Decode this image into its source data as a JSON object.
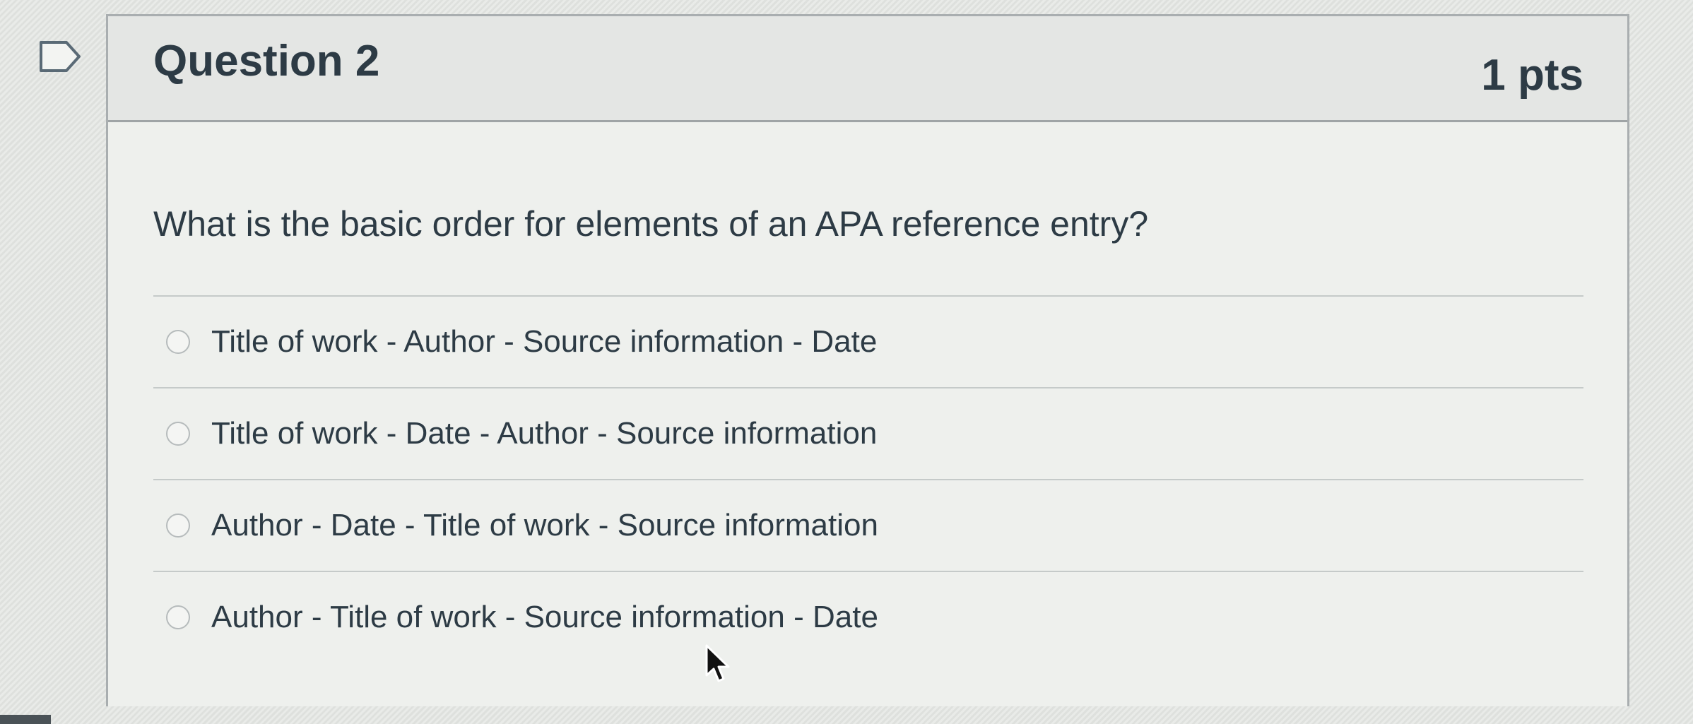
{
  "question": {
    "title": "Question 2",
    "points": "1 pts",
    "text": "What is the basic order for elements of an APA reference entry?",
    "flag_icon": "flag-outline-icon",
    "answers": [
      {
        "label": "Title of work - Author - Source information - Date",
        "selected": false
      },
      {
        "label": "Title of work - Date - Author - Source information",
        "selected": false
      },
      {
        "label": "Author - Date - Title of work - Source information",
        "selected": false
      },
      {
        "label": "Author - Title of work - Source information - Date",
        "selected": false
      }
    ]
  },
  "colors": {
    "text": "#2d3b45",
    "header_bg": "#e4e6e4",
    "border": "#a9aeb0"
  }
}
